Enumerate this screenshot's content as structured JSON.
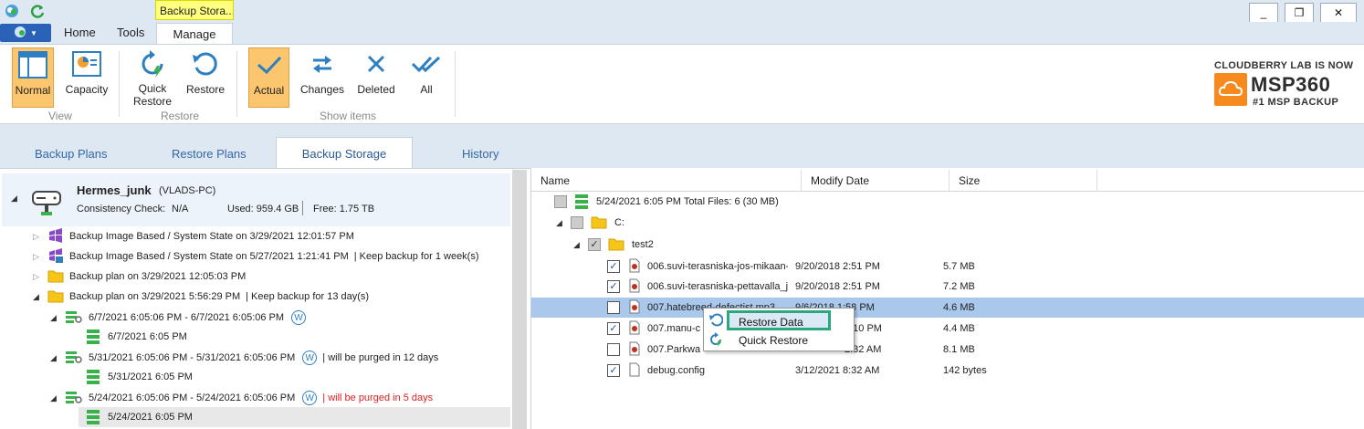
{
  "titlebar": {
    "context_tab": "Backup Stora...",
    "min_glyph": "_",
    "max_glyph": "❐",
    "close_glyph": "✕"
  },
  "ribbon_tabs": [
    "Home",
    "Tools",
    "Manage"
  ],
  "ribbon": {
    "view_group": {
      "label": "View",
      "normal": "Normal",
      "capacity": "Capacity"
    },
    "restore_group": {
      "label": "Restore",
      "quick_restore_line1": "Quick",
      "quick_restore_line2": "Restore",
      "restore": "Restore"
    },
    "show_group": {
      "label": "Show items",
      "actual": "Actual",
      "changes": "Changes",
      "deleted": "Deleted",
      "all": "All"
    }
  },
  "brand": {
    "line1": "CLOUDBERRY LAB IS NOW",
    "name": "MSP360",
    "tagline": "#1 MSP BACKUP"
  },
  "nav_tabs": [
    "Backup Plans",
    "Restore Plans",
    "Backup Storage",
    "History"
  ],
  "storage": {
    "name": "Hermes_junk",
    "computer": "(VLADS-PC)",
    "consistency_label": "Consistency Check:",
    "consistency_value": "N/A",
    "used": "Used: 959.4 GB",
    "free": "Free: 1.75 TB"
  },
  "tree": [
    {
      "text": "Backup Image Based / System State on 3/29/2021 12:01:57 PM",
      "extra": ""
    },
    {
      "text": "Backup Image Based / System State on 5/27/2021 1:21:41 PM",
      "extra": "|   Keep backup for 1 week(s)"
    },
    {
      "text": "Backup plan on 3/29/2021 12:05:03 PM",
      "extra": ""
    },
    {
      "text": "Backup plan on 3/29/2021 5:56:29 PM",
      "extra": "|   Keep backup for 13 day(s)"
    }
  ],
  "versions": [
    {
      "range": "6/7/2021 6:05:06 PM - 6/7/2021 6:05:06 PM",
      "badge": "W",
      "note": "",
      "child": "6/7/2021 6:05 PM"
    },
    {
      "range": "5/31/2021 6:05:06 PM - 5/31/2021 6:05:06 PM",
      "badge": "W",
      "note": "| will be purged in 12 days",
      "child": "5/31/2021 6:05 PM"
    },
    {
      "range": "5/24/2021 6:05:06 PM - 5/24/2021 6:05:06 PM",
      "badge": "W",
      "note": "| will be purged in 5 days",
      "child": "5/24/2021 6:05 PM"
    }
  ],
  "columns": [
    "Name",
    "Modify Date",
    "Size"
  ],
  "files_root": {
    "label": "5/24/2021 6:05 PM  Total Files:  6 (30 MB)",
    "drive": "C:",
    "folder": "test2"
  },
  "files": [
    {
      "name": "006.suvi-terasniska-jos-mikaan-",
      "date": "9/20/2018 2:51 PM",
      "size": "5.7 MB",
      "checked": true
    },
    {
      "name": "006.suvi-terasniska-pettavalla_ja",
      "date": "9/20/2018 2:51 PM",
      "size": "7.2 MB",
      "checked": true
    },
    {
      "name": "007.hatebreed-defectist.mp3",
      "date": "9/6/2018 1:58 PM",
      "size": "4.6 MB",
      "checked": false
    },
    {
      "name": "007.manu-c",
      "date": "2:10 PM",
      "size": "4.4 MB",
      "checked": true
    },
    {
      "name": "007.Parkwa",
      "date": "2:32 AM",
      "size": "8.1 MB",
      "checked": false
    },
    {
      "name": "debug.config",
      "date": "3/12/2021 8:32 AM",
      "size": "142 bytes",
      "checked": true
    }
  ],
  "context_menu": {
    "restore_data": "Restore Data",
    "quick_restore": "Quick Restore"
  }
}
